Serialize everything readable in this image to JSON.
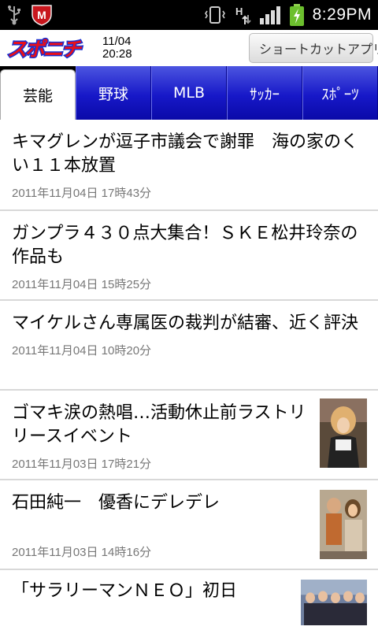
{
  "status_bar": {
    "time": "8:29PM",
    "icons": [
      "usb-icon",
      "mcafee-icon",
      "vibrate-icon",
      "hspa-icon",
      "signal-icon",
      "battery-icon"
    ]
  },
  "header": {
    "logo_text": "スポニチ",
    "date": "11/04",
    "time": "20:28",
    "shortcut_label": "ショートカットアプリ"
  },
  "tabs": [
    {
      "label": "芸能",
      "active": true
    },
    {
      "label": "野球",
      "active": false
    },
    {
      "label": "MLB",
      "active": false
    },
    {
      "label": "ｻｯｶｰ",
      "active": false
    },
    {
      "label": "ｽﾎﾟｰﾂ",
      "active": false
    }
  ],
  "articles": [
    {
      "title": "キマグレンが逗子市議会で謝罪　海の家のくい１１本放置",
      "date": "2011年11月04日 17時43分"
    },
    {
      "title": "ガンプラ４３０点大集合！ＳＫＥ松井玲奈の作品も",
      "date": "2011年11月04日 15時25分"
    },
    {
      "title": "マイケルさん専属医の裁判が結審、近く評決",
      "date": "2011年11月04日 10時20分"
    },
    {
      "title": "ゴマキ涙の熱唱…活動休止前ラストリリースイベント",
      "date": "2011年11月03日 17時21分"
    },
    {
      "title": "石田純一　優香にデレデレ",
      "date": "2011年11月03日 14時16分"
    },
    {
      "title": "「サラリーマンＮＥＯ」初日",
      "date": ""
    }
  ],
  "colors": {
    "tab_blue": "#1718c8",
    "logo_red": "#e8101a",
    "logo_blue": "#1a2fd0",
    "date_gray": "#777777",
    "divider": "#d8d8d8"
  }
}
